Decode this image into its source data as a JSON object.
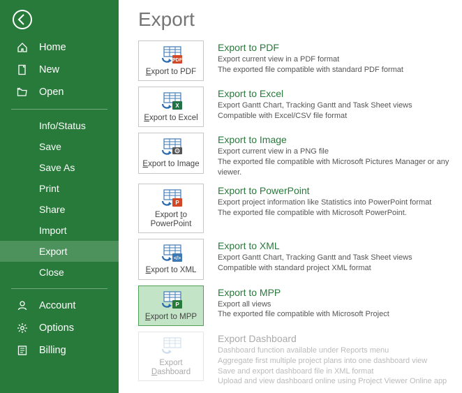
{
  "sidebar": {
    "primary": [
      {
        "label": "Home",
        "icon": "home"
      },
      {
        "label": "New",
        "icon": "new"
      },
      {
        "label": "Open",
        "icon": "open"
      }
    ],
    "file_ops": [
      {
        "label": "Info/Status"
      },
      {
        "label": "Save"
      },
      {
        "label": "Save As"
      },
      {
        "label": "Print"
      },
      {
        "label": "Share"
      },
      {
        "label": "Import"
      },
      {
        "label": "Export",
        "selected": true
      },
      {
        "label": "Close"
      }
    ],
    "bottom": [
      {
        "label": "Account",
        "icon": "account"
      },
      {
        "label": "Options",
        "icon": "options"
      },
      {
        "label": "Billing",
        "icon": "billing"
      }
    ]
  },
  "page": {
    "title": "Export"
  },
  "export_options": [
    {
      "tile_label": "Export to PDF",
      "hotkey_index": 0,
      "desc_title": "Export to PDF",
      "lines": [
        "Export current view in a PDF format",
        "The exported file compatible with standard PDF format"
      ],
      "icon": "pdf"
    },
    {
      "tile_label": "Export to Excel",
      "hotkey_index": 0,
      "desc_title": "Export to Excel",
      "lines": [
        "Export Gantt Chart, Tracking Gantt and Task Sheet views",
        "Compatible with Excel/CSV file format"
      ],
      "icon": "excel"
    },
    {
      "tile_label": "Export to Image",
      "hotkey_index": 0,
      "desc_title": "Export to Image",
      "lines": [
        "Export current view in a PNG file",
        "The exported file compatible with Microsoft Pictures Manager or any viewer."
      ],
      "icon": "image"
    },
    {
      "tile_label": "Export to PowerPoint",
      "hotkey_index": 7,
      "desc_title": "Export to PowerPoint",
      "lines": [
        "Export project information like Statistics into PowerPoint format",
        "The exported file compatible with Microsoft PowerPoint."
      ],
      "icon": "ppt"
    },
    {
      "tile_label": "Export to XML",
      "hotkey_index": 0,
      "desc_title": "Export to XML",
      "lines": [
        "Export Gantt Chart, Tracking Gantt and Task Sheet views",
        "Compatible with standard project XML format"
      ],
      "icon": "xml"
    },
    {
      "tile_label": "Export to MPP",
      "hotkey_index": 0,
      "selected": true,
      "desc_title": "Export to MPP",
      "lines": [
        "Export all views",
        "The exported file compatible with Microsoft Project"
      ],
      "icon": "mpp"
    },
    {
      "tile_label": "Export Dashboard",
      "hotkey_index": 7,
      "disabled": true,
      "desc_title": "Export Dashboard",
      "lines": [
        "Dashboard function available under Reports menu",
        "Aggregate first multiple project plans into one dashboard view",
        "Save and export dashboard file in XML format",
        "Upload and view dashboard online using Project Viewer Online app"
      ],
      "icon": "dashboard"
    }
  ]
}
